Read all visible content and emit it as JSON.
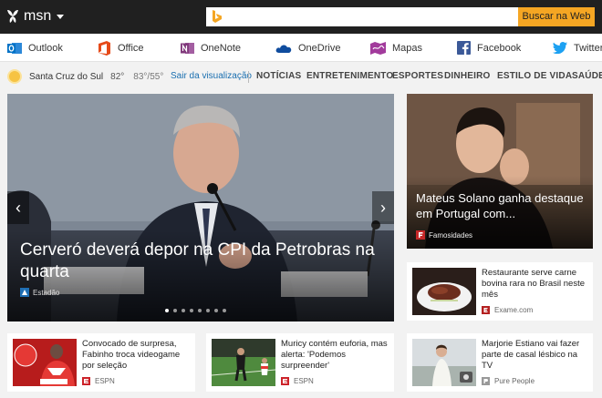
{
  "topbar": {
    "logo": "msn",
    "search_placeholder": "",
    "search_button": "Buscar na Web"
  },
  "apps": [
    {
      "label": "Outlook",
      "icon": "outlook-icon",
      "color": "#0072c6"
    },
    {
      "label": "Office",
      "icon": "office-icon",
      "color": "#e64a19"
    },
    {
      "label": "OneNote",
      "icon": "onenote-icon",
      "color": "#80397b"
    },
    {
      "label": "OneDrive",
      "icon": "onedrive-icon",
      "color": "#0f4c9e"
    },
    {
      "label": "Mapas",
      "icon": "maps-icon",
      "color": "#a23b9c"
    },
    {
      "label": "Facebook",
      "icon": "facebook-icon",
      "color": "#3b5998"
    },
    {
      "label": "Twitter",
      "icon": "twitter-icon",
      "color": "#1da1f2"
    }
  ],
  "weather": {
    "city": "Santa Cruz do Sul",
    "temp": "82°",
    "range": "83°/55°"
  },
  "exit_link": "Sair da visualização",
  "nav": [
    "NOTÍCIAS",
    "ENTRETENIMENTO",
    "ESPORTES",
    "DINHEIRO",
    "ESTILO DE VIDA",
    "SAÚDE E"
  ],
  "hero": {
    "title": "Cerveró deverá depor na CPI da Petrobras na quarta",
    "source": "Estadão",
    "slide_index": 1,
    "slide_count": 8,
    "prev": "‹",
    "next": "›"
  },
  "feature": {
    "title": "Mateus Solano ganha destaque em Portugal com...",
    "source": "Famosidades"
  },
  "cards": [
    {
      "title": "Restaurante serve carne bovina rara no Brasil neste mês",
      "source": "Exame.com",
      "src_color": "#b42020"
    },
    {
      "title": "Convocado de surpresa, Fabinho troca videogame por seleção",
      "source": "ESPN",
      "src_color": "#cc2229"
    },
    {
      "title": "Muricy contém euforia, mas alerta: 'Podemos surpreender'",
      "source": "ESPN",
      "src_color": "#cc2229"
    },
    {
      "title": "Marjorie Estiano vai fazer parte de casal lésbico na TV",
      "source": "Pure People",
      "src_color": "#999999"
    }
  ],
  "colors": {
    "topbar": "#202020",
    "search_button": "#f5a623",
    "link": "#1a6fb0"
  }
}
